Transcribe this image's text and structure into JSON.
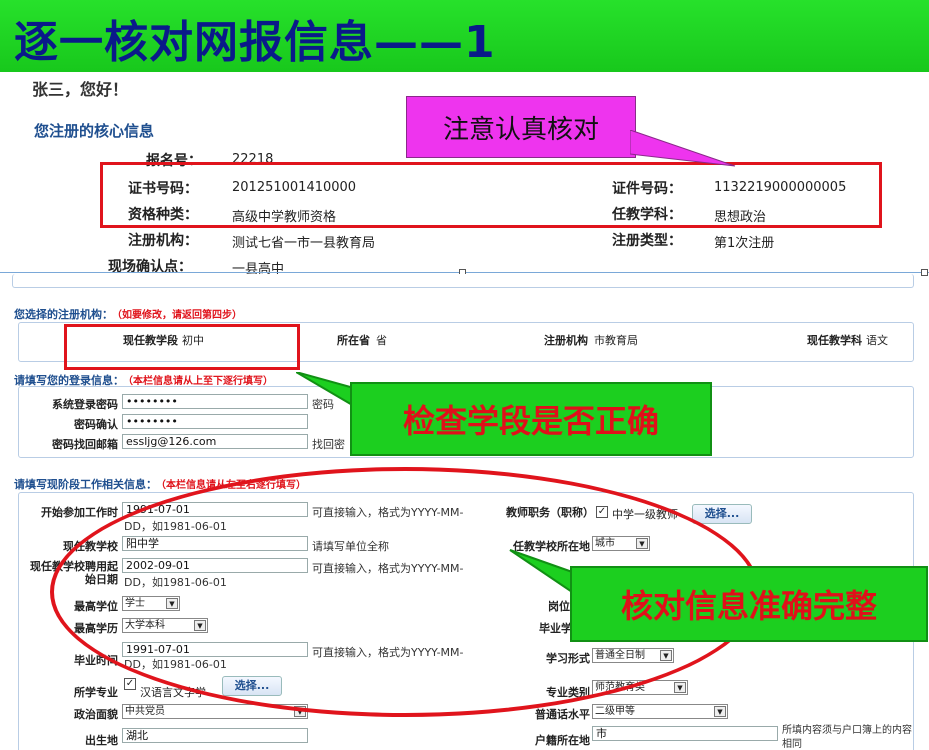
{
  "banner": {
    "title": "逐一核对网报信息——1"
  },
  "top": {
    "greeting": "张三，您好！",
    "core_title": "您注册的核心信息",
    "rows": {
      "reg_no_label": "报名号：",
      "reg_no": "22218",
      "cert_no_label": "证书号码：",
      "cert_no": "201251001410000",
      "id_no_label": "证件号码：",
      "id_no": "1132219000000005",
      "qual_label": "资格种类：",
      "qual": "高级中学教师资格",
      "subject_label": "任教学科：",
      "subject": "思想政治",
      "org_label": "注册机构：",
      "org": "测试七省一市一县教育局",
      "type_label": "注册类型：",
      "type": "第1次注册",
      "site_label": "现场确认点：",
      "site": "一县高中"
    }
  },
  "callouts": {
    "careful": "注意认真核对",
    "check_stage": "检查学段是否正确",
    "check_complete": "核对信息准确完整"
  },
  "form": {
    "sec1": {
      "title": "您选择的注册机构：",
      "note": "（如要修改，请返回第四步）"
    },
    "sec1_fields": {
      "stage_label": "现任教学段",
      "stage": "初中",
      "province_label": "所在省",
      "province": "省",
      "org_label": "注册机构",
      "org": "市教育局",
      "subject_label": "现任教学科",
      "subject": "语文"
    },
    "sec2": {
      "title": "请填写您的登录信息：",
      "note": "（本栏信息请从上至下逐行填写）"
    },
    "sec2_fields": {
      "pwd_label": "系统登录密码",
      "pwd": "••••••••",
      "pwd_hint": "密码",
      "confirm_label": "密码确认",
      "confirm": "••••••••",
      "email_label": "密码找回邮箱",
      "email": "essljg@126.com",
      "email_hint": "找回密"
    },
    "sec3": {
      "title": "请填写现阶段工作相关信息：",
      "note": "（本栏信息请从左至右逐行填写）"
    },
    "sec3_fields": {
      "work_start_label": "开始参加工作时",
      "work_start": "1991-07-01",
      "date_hint": "可直接输入，格式为YYYY-MM-",
      "date_hint2": "DD，如1981-06-01",
      "title_label": "教师职务（职称）",
      "title_value": "中学一级教师",
      "choose": "选择...",
      "school_label": "现任教学校",
      "school": "阳中学",
      "school_hint": "请填写单位全称",
      "school_loc_label": "任教学校所在地",
      "school_loc": "城市",
      "hire_label": "现任教学校聘用起始日期",
      "hire": "2002-09-01",
      "degree_label": "最高学位",
      "degree": "学士",
      "post_label": "岗位",
      "edu_label": "最高学历",
      "edu": "大学本科",
      "grad_school_label": "毕业学",
      "grad_time_label": "毕业时间",
      "grad_time": "1991-07-01",
      "study_form_label": "学习形式",
      "study_form": "普通全日制",
      "major_label": "所学专业",
      "major": "汉语言文字学",
      "major_type_label": "专业类别",
      "major_type": "师范教育类",
      "politics_label": "政治面貌",
      "politics": "中共党员",
      "level_label": "普通话水平",
      "level": "二级甲等",
      "birthplace_label": "出生地",
      "birthplace": "湖北",
      "huji_label": "户籍所在地",
      "huji": "市",
      "huji_hint": "所填内容须与户口簿上的内容相同"
    }
  }
}
